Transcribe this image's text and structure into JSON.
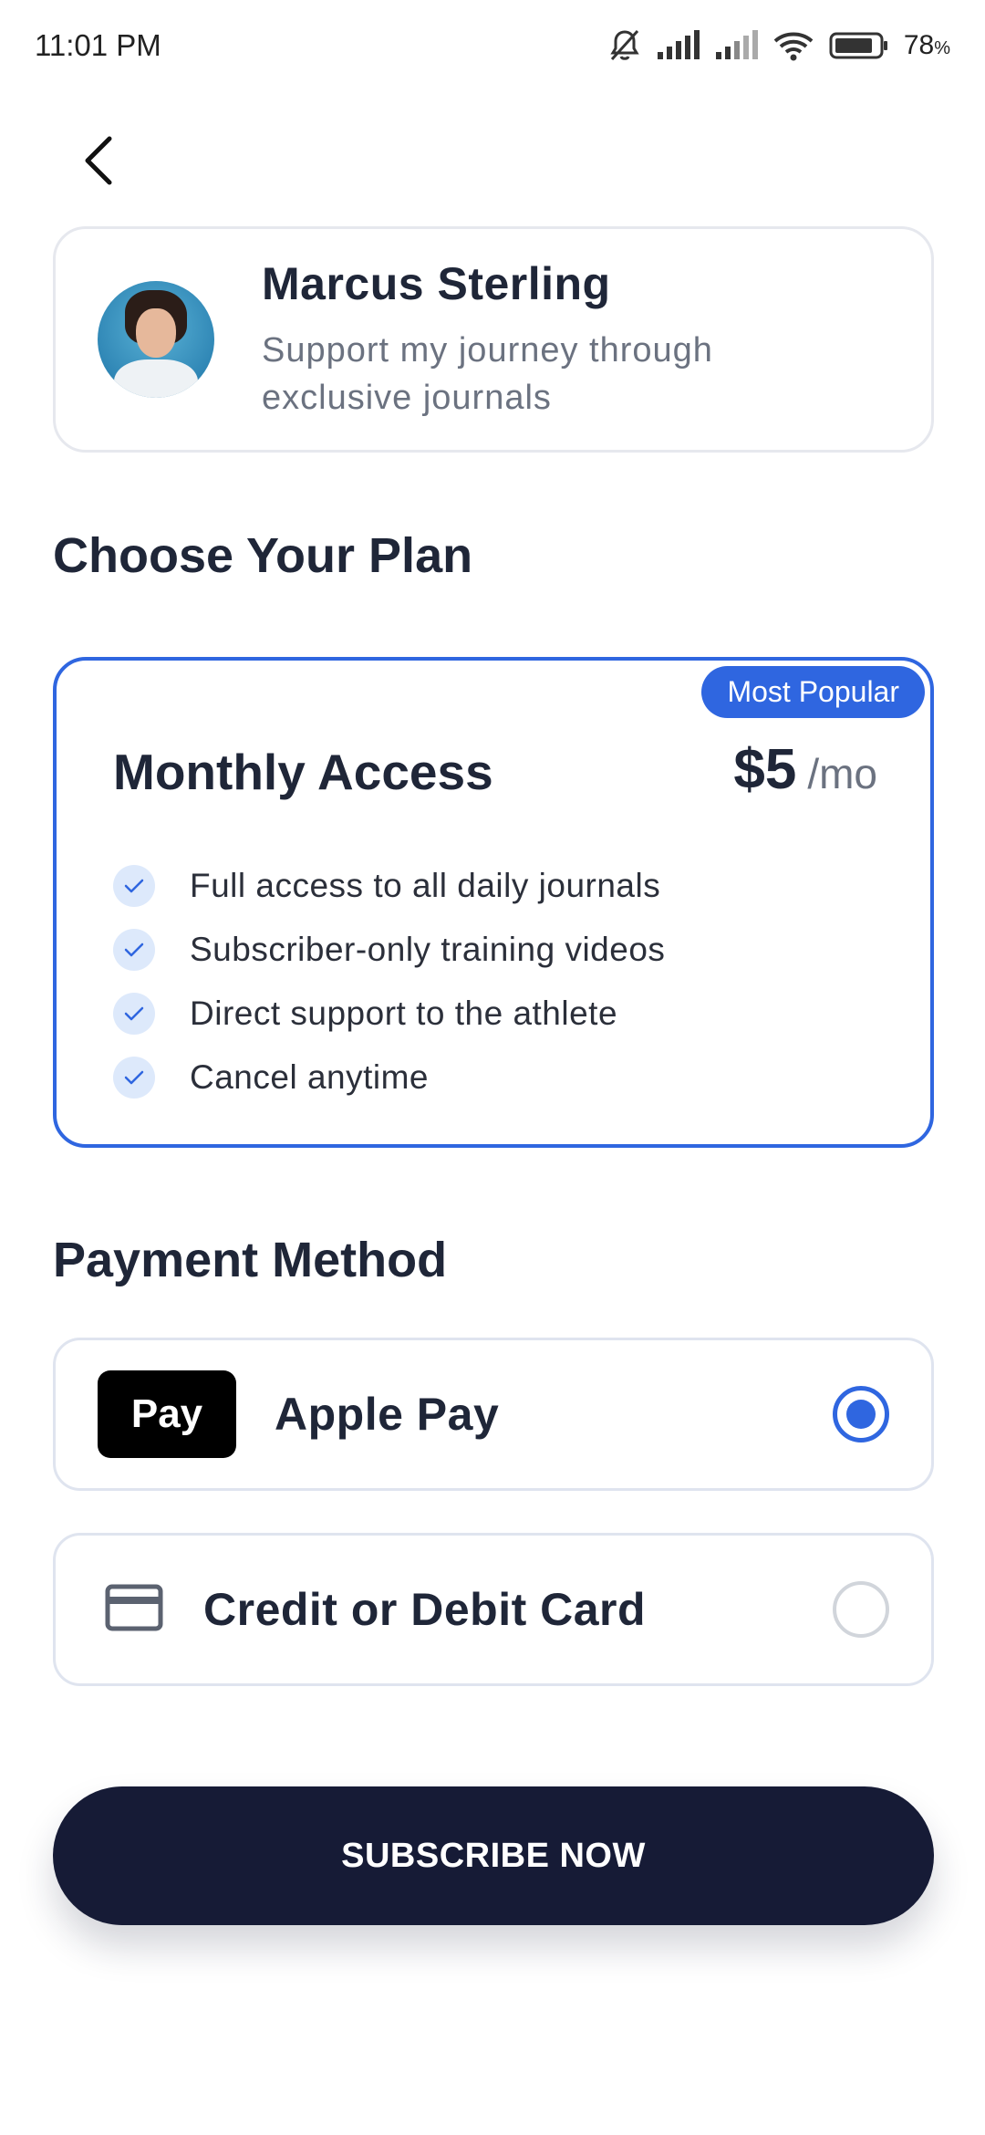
{
  "status_bar": {
    "time": "11:01 PM",
    "battery": "78"
  },
  "profile": {
    "name": "Marcus Sterling",
    "bio": "Support my journey through exclusive journals"
  },
  "plan_section": {
    "title": "Choose Your Plan"
  },
  "plan": {
    "badge": "Most Popular",
    "name": "Monthly Access",
    "price": "$5",
    "period": "/mo",
    "features": [
      "Full access to all daily journals",
      "Subscriber-only training videos",
      "Direct support to the athlete",
      "Cancel anytime"
    ]
  },
  "payment_section": {
    "title": "Payment Method"
  },
  "payment_options": {
    "apple_pay": {
      "logo_text": "Pay",
      "label": "Apple Pay",
      "selected": true
    },
    "card": {
      "label": "Credit or Debit Card",
      "selected": false
    }
  },
  "subscribe": {
    "label": "SUBSCRIBE NOW"
  },
  "colors": {
    "accent": "#2f66e0",
    "button": "#161b36",
    "text": "#1f2638",
    "muted": "#6b7280"
  }
}
